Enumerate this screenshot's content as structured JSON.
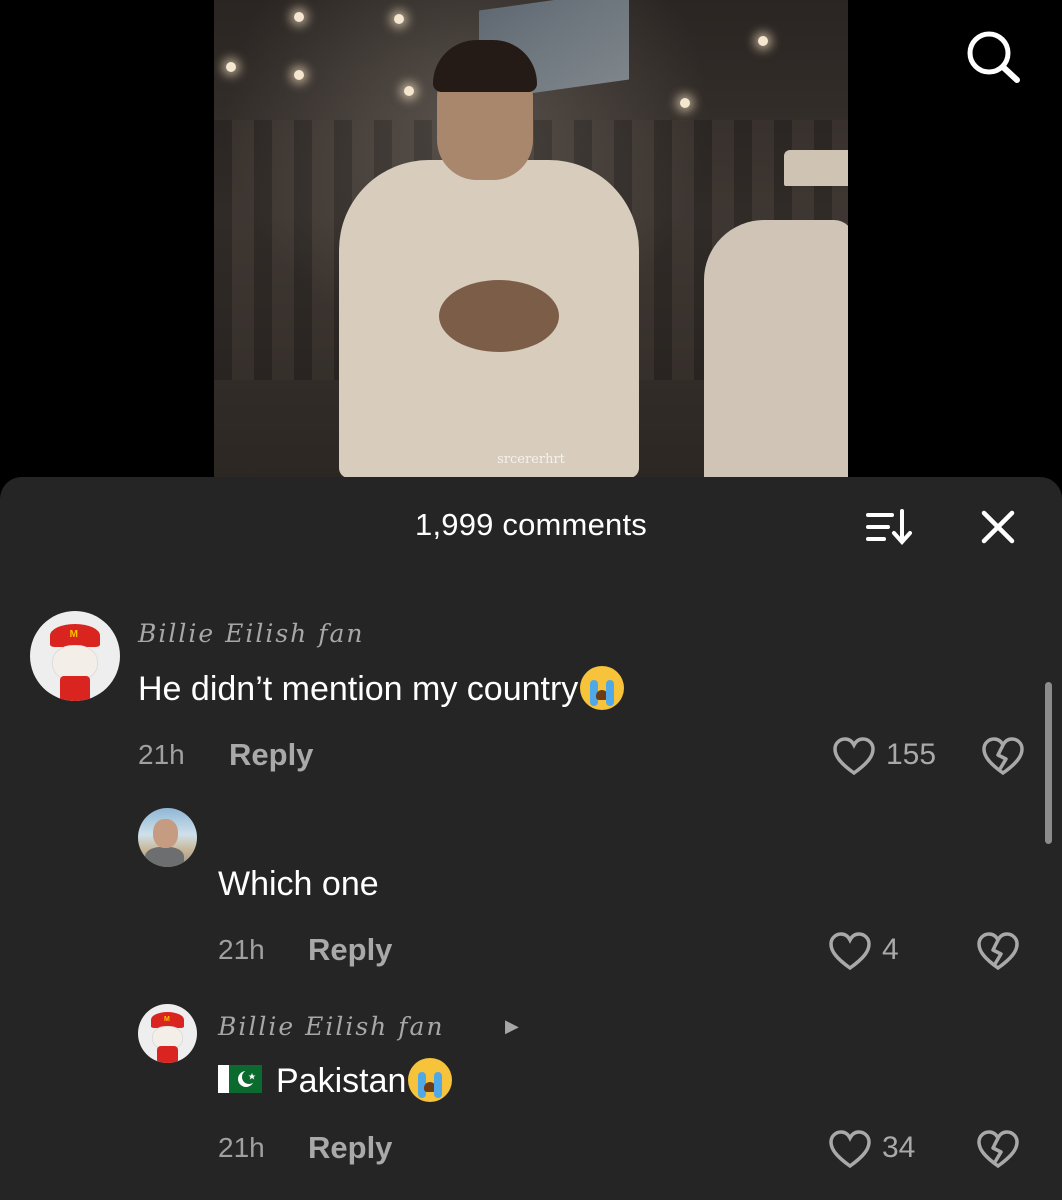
{
  "video": {
    "watermark": "srcererhrt"
  },
  "sheet": {
    "title": "1,999 comments"
  },
  "comments": [
    {
      "username": "Billie Eilish fan",
      "text": "He didn’t mention my country",
      "time": "21h",
      "reply_label": "Reply",
      "likes": "155"
    },
    {
      "username": "",
      "text": "Which one",
      "time": "21h",
      "reply_label": "Reply",
      "likes": "4"
    },
    {
      "username": "Billie Eilish fan",
      "text": "Pakistan",
      "time": "21h",
      "reply_label": "Reply",
      "likes": "34"
    }
  ],
  "icons": {
    "search": "search-icon",
    "sort": "sort-icon",
    "close": "close-icon",
    "like": "heart-icon",
    "dislike": "broken-heart-icon",
    "emoji": "loudly-crying-face-emoji",
    "flag": "pakistan-flag-emoji"
  },
  "colors": {
    "sheet_bg": "#252525",
    "muted_text": "#a9a9a9",
    "primary_text": "#ffffff"
  }
}
